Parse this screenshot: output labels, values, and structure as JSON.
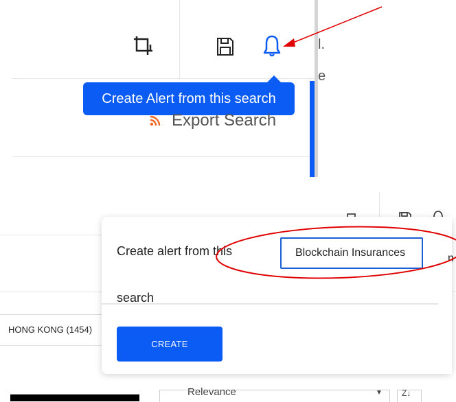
{
  "top": {
    "tooltip_text": "Create Alert from this search",
    "export_label": "Export Search",
    "clipped_char_1": "l.",
    "clipped_char_2": "e",
    "icons": [
      "crop-icon",
      "save-icon",
      "bell-icon",
      "rss-icon"
    ]
  },
  "bottom": {
    "popup": {
      "label_line_1": "Create alert from this",
      "label_line_2": "search",
      "input_value": "Blockchain Insurances",
      "create_label": "CREATE",
      "clipped_char": "n"
    },
    "filter_item": "HONG KONG (1454)",
    "sort_select_value": "Relevance",
    "sort_direction_label": "Z↓",
    "icons": [
      "crop-icon",
      "save-icon",
      "bell-icon"
    ]
  },
  "colors": {
    "accent_blue": "#0a5cf5",
    "annotation_red": "#e00000",
    "rss_orange": "#f26522"
  }
}
